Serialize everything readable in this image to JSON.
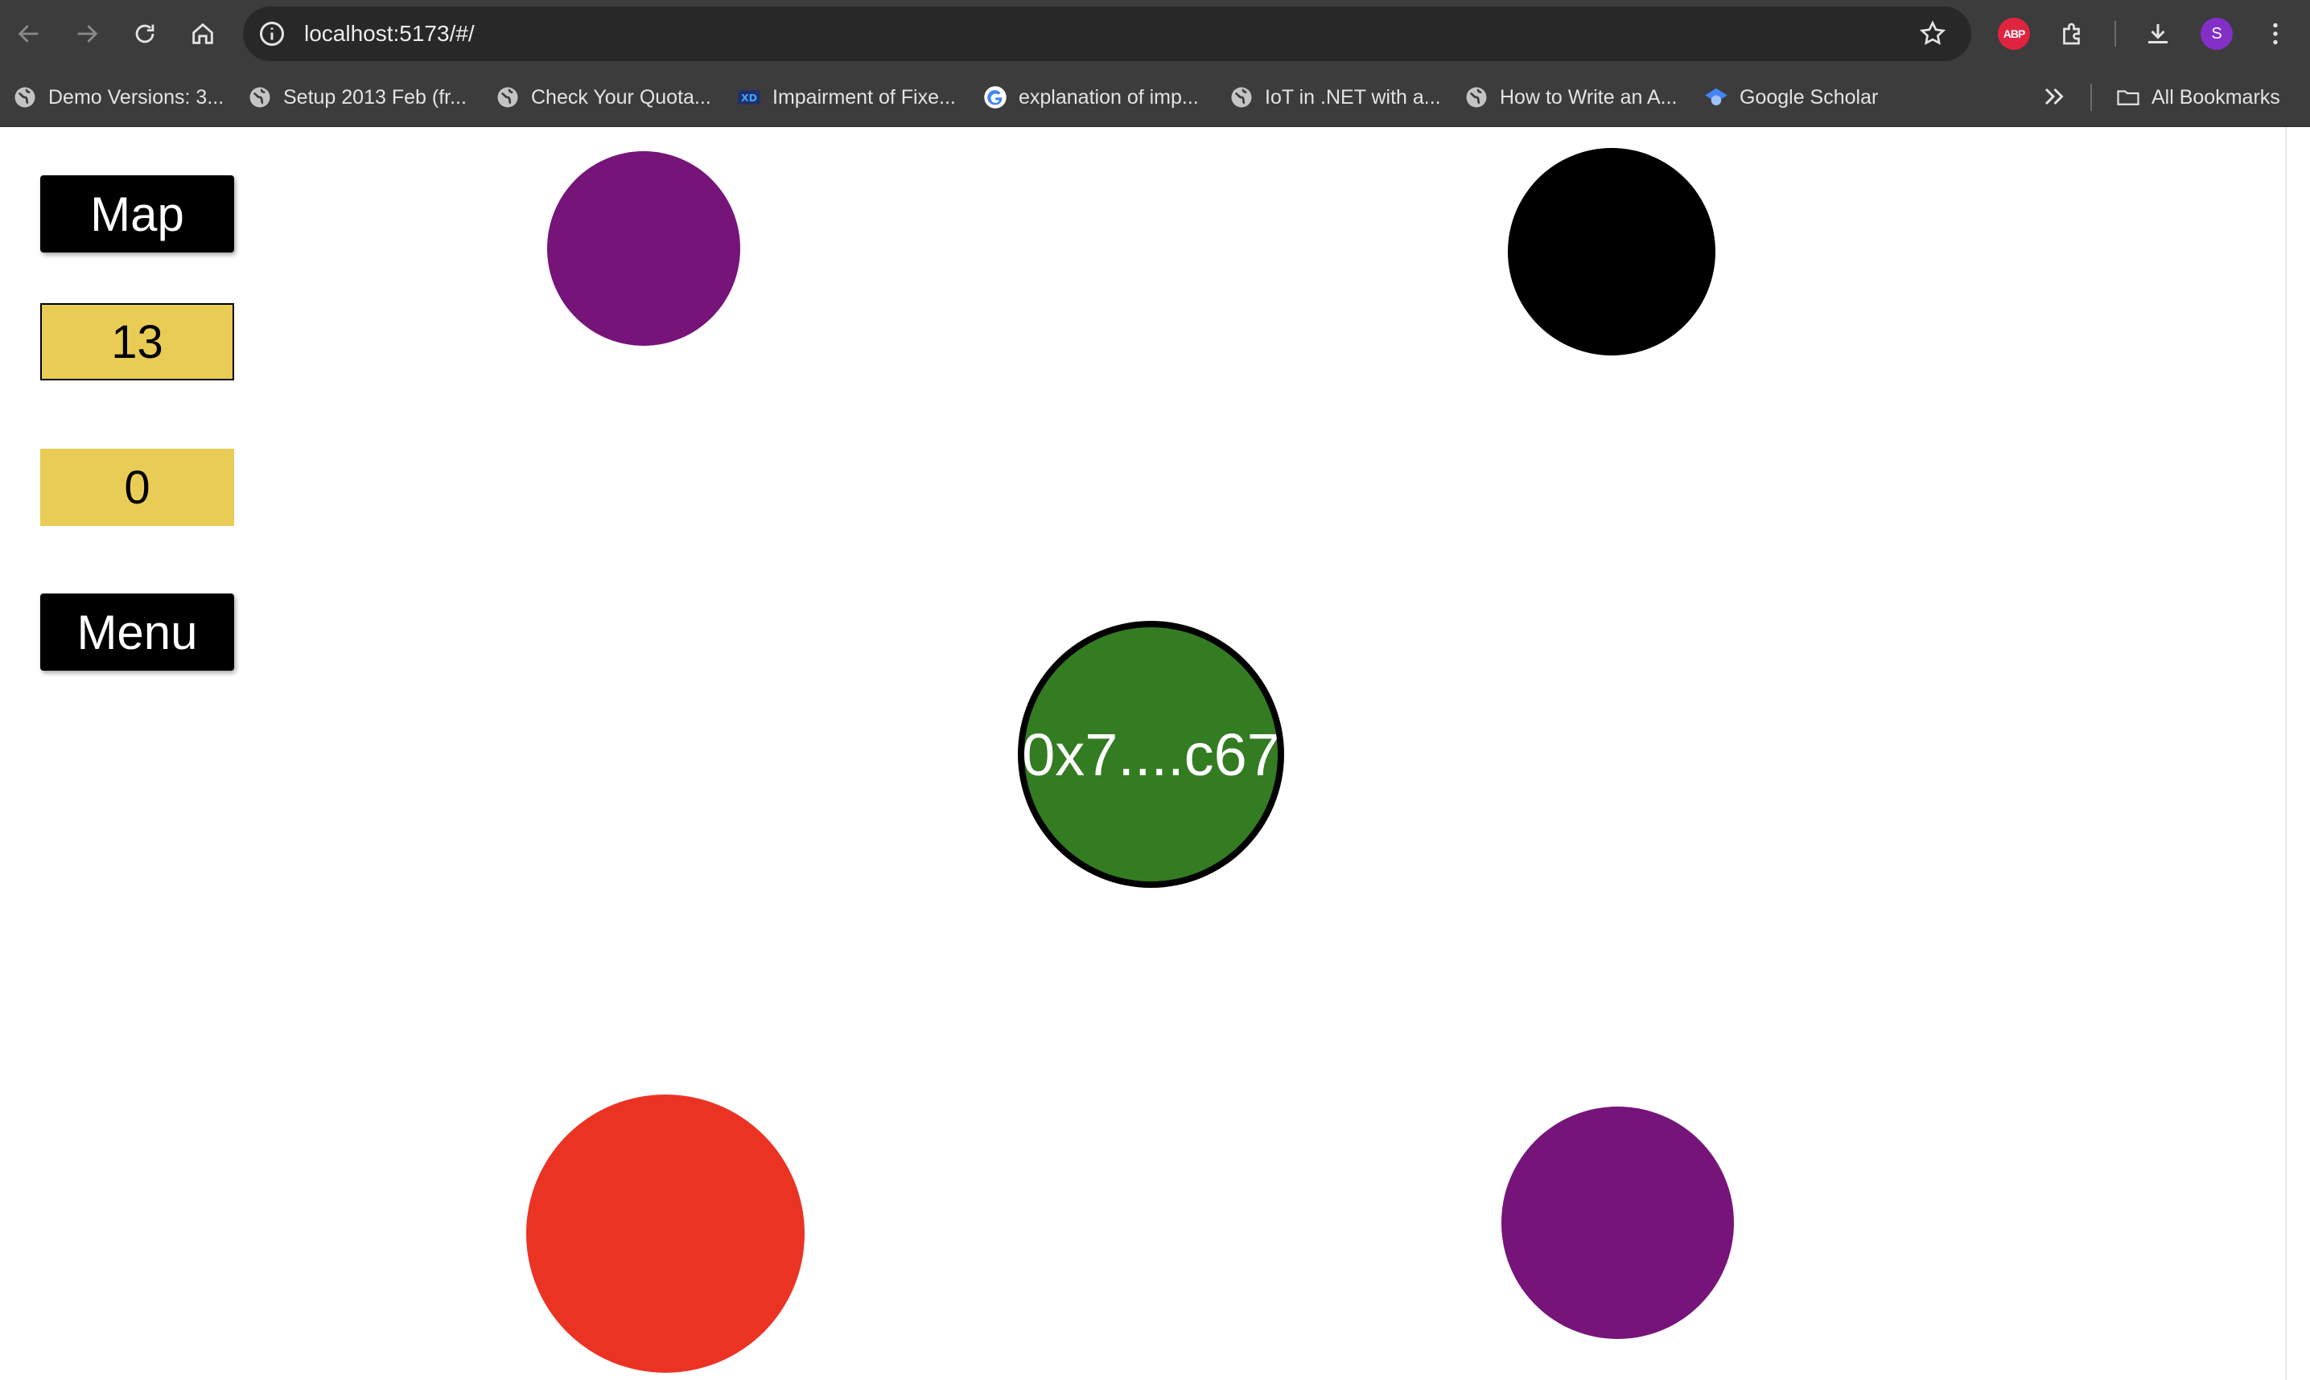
{
  "browser": {
    "url": "localhost:5173/#/",
    "profile_initial": "S",
    "extension_label": "ABP",
    "bookmarks": [
      {
        "label": "Demo Versions: 3...",
        "icon": "globe-icon"
      },
      {
        "label": "Setup 2013 Feb (fr...",
        "icon": "globe-icon"
      },
      {
        "label": "Check Your Quota...",
        "icon": "globe-icon"
      },
      {
        "label": "Impairment of Fixe...",
        "icon": "xd-icon"
      },
      {
        "label": "explanation of imp...",
        "icon": "google-icon"
      },
      {
        "label": "IoT in .NET with a...",
        "icon": "globe-icon"
      },
      {
        "label": "How to Write an A...",
        "icon": "globe-icon"
      },
      {
        "label": "Google Scholar",
        "icon": "scholar-icon"
      }
    ],
    "all_bookmarks_label": "All Bookmarks"
  },
  "sidebar": {
    "map_label": "Map",
    "counter_1": "13",
    "counter_2": "0",
    "menu_label": "Menu"
  },
  "board": {
    "player_label": "0x7....c67",
    "player_color": "#347c22",
    "circles": [
      {
        "name": "purple-circle-top",
        "color": "#76147a"
      },
      {
        "name": "black-circle",
        "color": "#000000"
      },
      {
        "name": "red-circle",
        "color": "#eb3324"
      },
      {
        "name": "purple-circle-bottom",
        "color": "#76147a"
      }
    ]
  }
}
